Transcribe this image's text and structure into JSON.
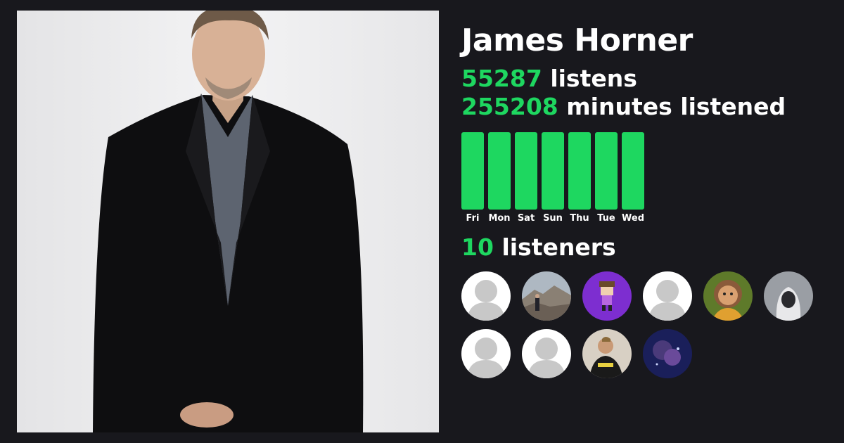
{
  "artist": {
    "name": "James Horner"
  },
  "stats": {
    "listens_value": "55287",
    "listens_label": "listens",
    "minutes_value": "255208",
    "minutes_label": "minutes listened"
  },
  "chart_data": {
    "type": "bar",
    "categories": [
      "Fri",
      "Mon",
      "Sat",
      "Sun",
      "Thu",
      "Tue",
      "Wed"
    ],
    "values": [
      1,
      1,
      1,
      1,
      1,
      1,
      1
    ],
    "title": "",
    "xlabel": "",
    "ylabel": "",
    "ylim": [
      0,
      1
    ],
    "grid": false,
    "color": "#1ed760"
  },
  "listeners": {
    "count_value": "10",
    "count_label": "listeners",
    "avatars": [
      {
        "kind": "default-avatar"
      },
      {
        "kind": "photo-mountain"
      },
      {
        "kind": "photo-pixel-character"
      },
      {
        "kind": "default-avatar"
      },
      {
        "kind": "photo-cartoon-face"
      },
      {
        "kind": "photo-hooded-figure"
      },
      {
        "kind": "default-avatar"
      },
      {
        "kind": "default-avatar"
      },
      {
        "kind": "photo-person-selfie"
      },
      {
        "kind": "photo-dark-blue"
      }
    ]
  },
  "colors": {
    "accent": "#1ed760",
    "background": "#18181d",
    "text": "#ffffff"
  }
}
